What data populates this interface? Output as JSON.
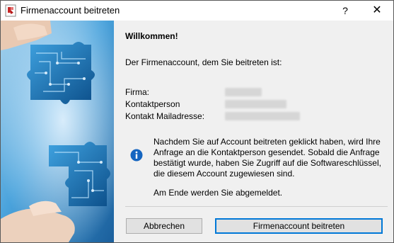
{
  "window": {
    "title": "Firmenaccount beitreten",
    "help_label": "?",
    "close_label": "✕"
  },
  "content": {
    "welcome": "Willkommen!",
    "intro": "Der Firmenaccount, dem Sie beitreten ist:",
    "fields": [
      {
        "label": "Firma:"
      },
      {
        "label": "Kontaktperson"
      },
      {
        "label": "Kontakt Mailadresse:"
      }
    ],
    "info_lines": [
      "Nachdem Sie auf Account beitreten geklickt haben, wird Ihre",
      "Anfrage an die Kontaktperson gesendet. Sobald die Anfrage",
      "bestätigt wurde, haben Sie Zugriff auf die Softwareschlüssel,",
      "die diesem Account zugewiesen sind."
    ],
    "logout_note": "Am Ende werden Sie abgemeldet."
  },
  "buttons": {
    "cancel": "Abbrechen",
    "join": "Firmenaccount beitreten"
  },
  "colors": {
    "banner_blue": "#2a8fd0",
    "primary_border": "#0078d7",
    "info_icon": "#1565c0"
  }
}
